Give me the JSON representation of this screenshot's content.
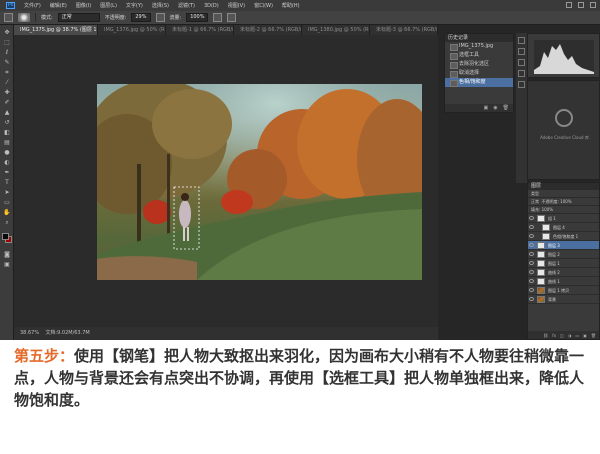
{
  "menu": {
    "items": [
      "文件(F)",
      "编辑(E)",
      "图像(I)",
      "图层(L)",
      "文字(Y)",
      "选择(S)",
      "滤镜(T)",
      "3D(D)",
      "视图(V)",
      "窗口(W)",
      "帮助(H)"
    ]
  },
  "options": {
    "mode_label": "模式:",
    "mode_value": "正常",
    "opacity_label": "不透明度:",
    "opacity_value": "29%",
    "flow_label": "流量:",
    "flow_value": "100%"
  },
  "tabs": [
    "IMG_1375.jpg @ 38.7% (图层 1 拷贝, RGB/8)",
    "IMG_1376.jpg @ 50% (RGB/8)",
    "未标题-1 @ 66.7% (RGB/8)",
    "未标题-2 @ 66.7% (RGB/8)",
    "IMG_1380.jpg @ 50% (RGB/8)",
    "未标题-3 @ 66.7% (RGB/8)"
  ],
  "status": {
    "zoom": "38.67%",
    "doc": "文档:9.02M/63.7M"
  },
  "history": {
    "title": "历史记录",
    "snapshot": "IMG_1375.jpg",
    "steps": [
      "选框工具",
      "去除羽化选区",
      "取消选择",
      "色相/饱和度"
    ],
    "selected_index": 3
  },
  "cc_panel": {
    "text": "Adobe Creative Cloud 库"
  },
  "layers": {
    "title": "图层",
    "filter_label": "类型",
    "blend_label": "正常",
    "opacity_label": "不透明度: 100%",
    "fill_label": "填充: 100%",
    "rows": [
      {
        "name": "组 1",
        "kind": "group",
        "indent": false,
        "selected": false
      },
      {
        "name": "图层 4",
        "kind": "white",
        "indent": true,
        "selected": false
      },
      {
        "name": "色相/饱和度 1",
        "kind": "white",
        "indent": true,
        "selected": false
      },
      {
        "name": "图层 3",
        "kind": "white",
        "indent": false,
        "selected": true
      },
      {
        "name": "图层 2",
        "kind": "white",
        "indent": false,
        "selected": false
      },
      {
        "name": "图层 1",
        "kind": "white",
        "indent": false,
        "selected": false
      },
      {
        "name": "曲线 2",
        "kind": "white",
        "indent": false,
        "selected": false
      },
      {
        "name": "曲线 1",
        "kind": "white",
        "indent": false,
        "selected": false
      },
      {
        "name": "图层 1 拷贝",
        "kind": "photo",
        "indent": false,
        "selected": false
      },
      {
        "name": "背景",
        "kind": "photo",
        "indent": false,
        "selected": false
      }
    ]
  },
  "caption": {
    "step": "第五步：",
    "text": "使用【钢笔】把人物大致抠出来羽化，因为画布大小稍有不人物要往稍微靠一点，人物与背景还会有点突出不协调，再使用【选框工具】把人物单独框出来，降低人物饱和度。"
  },
  "colors": {
    "accent": "#e56a2a",
    "caption_text": "#333333",
    "selection_blue": "#4a6fa0",
    "background_swatch": "#a20000"
  }
}
